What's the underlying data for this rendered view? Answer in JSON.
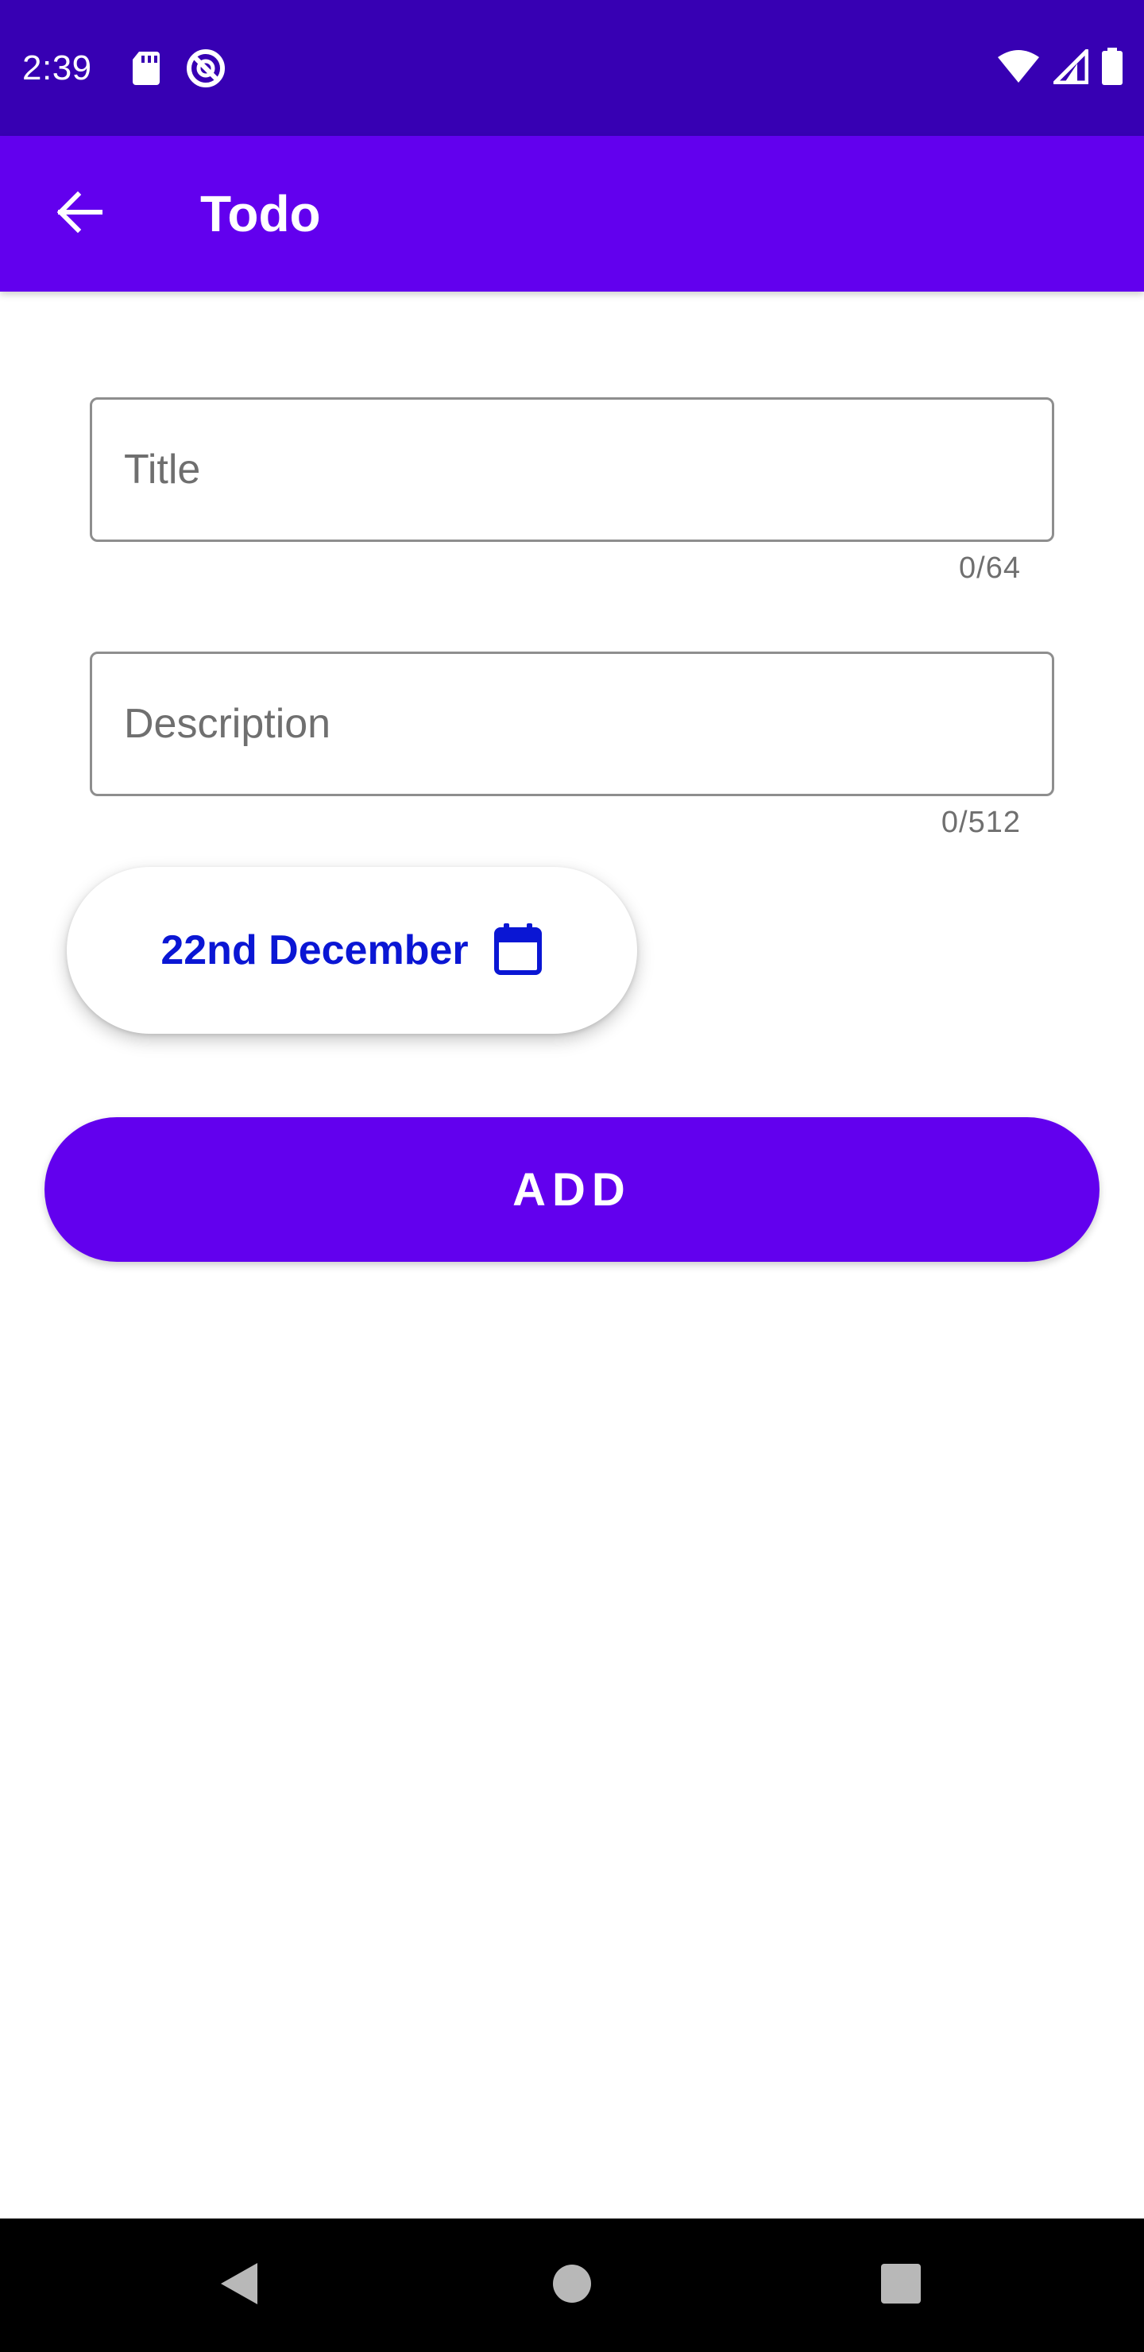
{
  "status_bar": {
    "time": "2:39",
    "icons": [
      "sd-card-icon",
      "do-not-disturb-icon",
      "wifi-icon",
      "signal-icon",
      "battery-icon"
    ]
  },
  "app_bar": {
    "title": "Todo",
    "back_icon": "arrow-back-icon",
    "color": "#6200EE"
  },
  "form": {
    "title_field": {
      "placeholder": "Title",
      "value": "",
      "counter": "0/64"
    },
    "description_field": {
      "placeholder": "Description",
      "value": "",
      "counter": "0/512"
    },
    "date_chip": {
      "label": "22nd December",
      "icon": "calendar-icon",
      "color": "#0A16D4"
    },
    "add_button": {
      "label": "ADD"
    }
  },
  "nav_bar": {
    "buttons": [
      "back-triangle-icon",
      "home-circle-icon",
      "recents-square-icon"
    ]
  },
  "colors": {
    "status_bar": "#3700B3",
    "primary": "#6200EE",
    "accent_text": "#0A16D4"
  }
}
